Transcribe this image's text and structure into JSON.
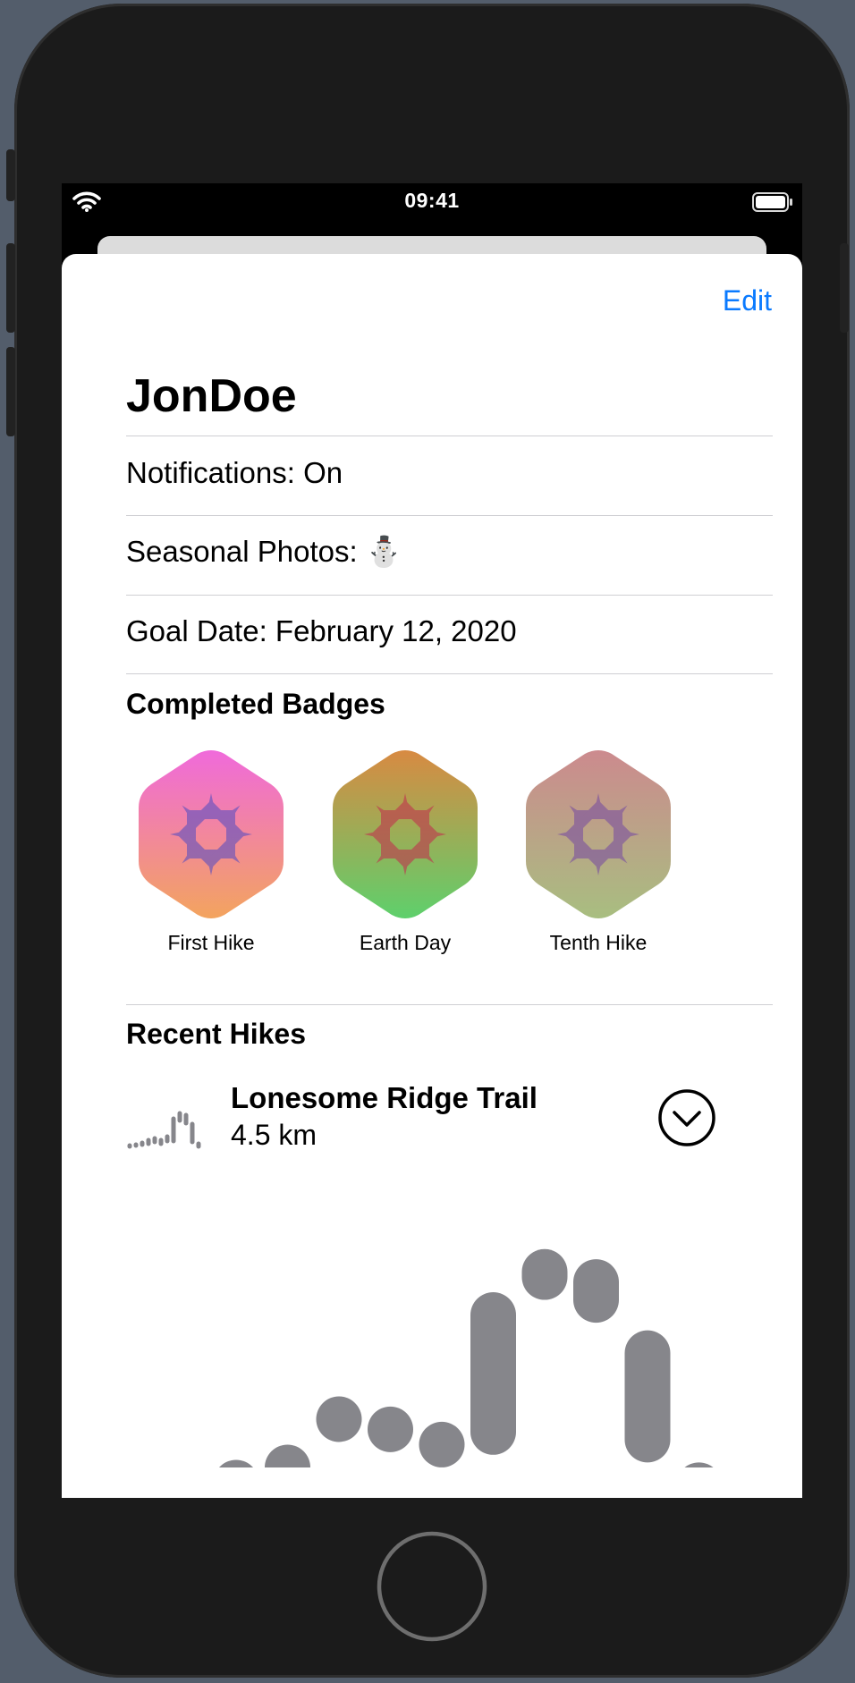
{
  "status_bar": {
    "time": "09:41",
    "wifi_icon": "wifi-icon",
    "battery_icon": "battery-icon"
  },
  "navigation": {
    "edit_label": "Edit"
  },
  "profile": {
    "username": "JonDoe",
    "notifications": "Notifications: On",
    "seasonal_photos": "Seasonal Photos: ⛄️",
    "goal_date": "Goal Date: February 12, 2020"
  },
  "badges": {
    "title": "Completed Badges",
    "items": [
      {
        "label": "First Hike",
        "gradient": [
          "#f06adb",
          "#f3a45e"
        ],
        "symbol_color": "#5b4fc0"
      },
      {
        "label": "Earth Day",
        "gradient": [
          "#d88a42",
          "#5ed06c"
        ],
        "symbol_color": "#c0334e"
      },
      {
        "label": "Tenth Hike",
        "gradient": [
          "#cc8a8e",
          "#a8be80"
        ],
        "symbol_color": "#7a4fa0"
      }
    ]
  },
  "recent_hikes": {
    "title": "Recent Hikes",
    "hike": {
      "name": "Lonesome Ridge Trail",
      "distance": "4.5 km",
      "expand_icon": "chevron-down-circle-icon"
    }
  },
  "chart_data": {
    "type": "bar",
    "style": "floating rounded capsules (elevation ranges along the hike)",
    "bar_color": "#86868b",
    "ylim": [
      0,
      100
    ],
    "ranges": [
      [
        -30,
        0
      ],
      [
        -10,
        3
      ],
      [
        -5,
        9
      ],
      [
        17,
        28
      ],
      [
        13,
        24
      ],
      [
        3,
        18
      ],
      [
        5,
        69
      ],
      [
        66,
        86
      ],
      [
        57,
        82
      ],
      [
        2,
        54
      ],
      [
        -10,
        2
      ]
    ]
  }
}
